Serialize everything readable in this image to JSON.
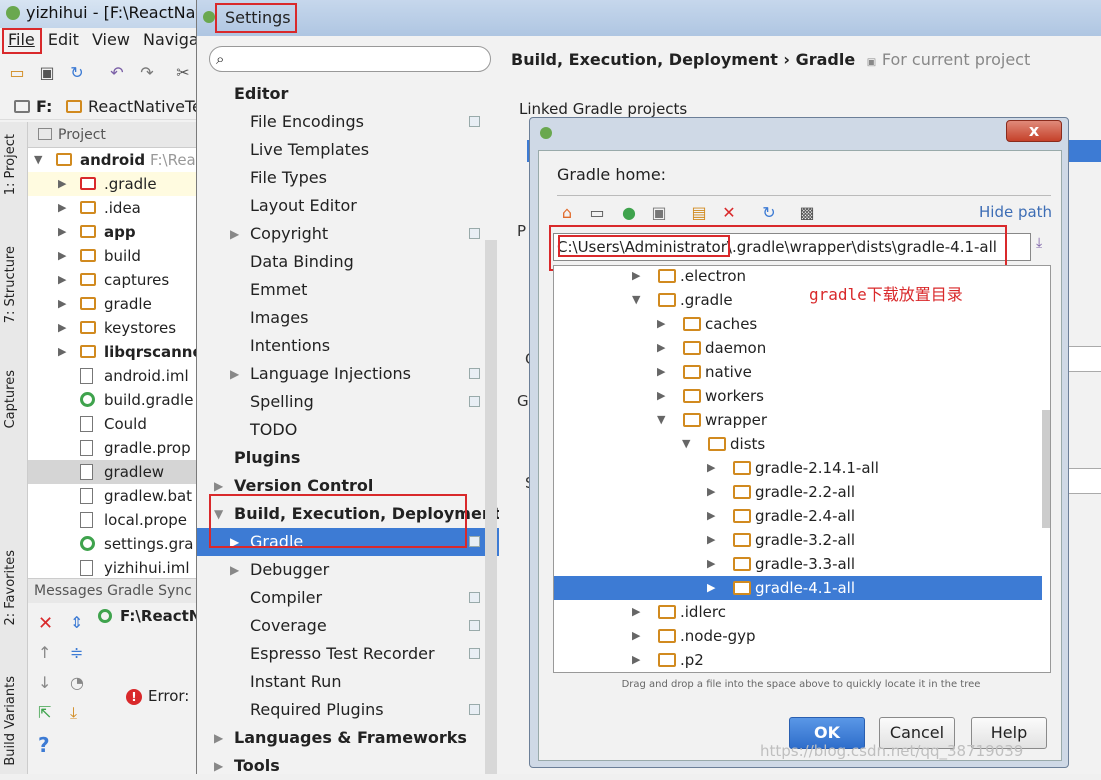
{
  "ide": {
    "title": "yizhihui - [F:\\ReactNativ",
    "menu": [
      "File",
      "Edit",
      "View",
      "Navigat"
    ],
    "breadcrumb": [
      "F:",
      "ReactNativeTe"
    ],
    "project_tab": "Project",
    "side_tabs": [
      "1: Project",
      "7: Structure",
      "Captures",
      "2: Favorites",
      "Build Variants"
    ],
    "tree": [
      {
        "label": "android",
        "extra": "F:\\Rea",
        "bold": true
      },
      {
        "label": ".gradle"
      },
      {
        "label": ".idea"
      },
      {
        "label": "app",
        "bold": true
      },
      {
        "label": "build"
      },
      {
        "label": "captures"
      },
      {
        "label": "gradle"
      },
      {
        "label": "keystores"
      },
      {
        "label": "libqrscanne",
        "bold": true
      },
      {
        "label": "android.iml"
      },
      {
        "label": "build.gradle"
      },
      {
        "label": "Could"
      },
      {
        "label": "gradle.prop"
      },
      {
        "label": "gradlew"
      },
      {
        "label": "gradlew.bat"
      },
      {
        "label": "local.prope"
      },
      {
        "label": "settings.gra"
      },
      {
        "label": "yizhihui.iml"
      }
    ],
    "messages_header": "Messages Gradle Sync",
    "messages_path": "F:\\ReactN",
    "error_text": "Error:"
  },
  "settings": {
    "title": "Settings",
    "search_placeholder": "",
    "tree": [
      {
        "label": "Editor",
        "bold": true
      },
      {
        "label": "File Encodings",
        "copy": true
      },
      {
        "label": "Live Templates"
      },
      {
        "label": "File Types"
      },
      {
        "label": "Layout Editor"
      },
      {
        "label": "Copyright",
        "arrow": true,
        "copy": true
      },
      {
        "label": "Data Binding"
      },
      {
        "label": "Emmet"
      },
      {
        "label": "Images"
      },
      {
        "label": "Intentions"
      },
      {
        "label": "Language Injections",
        "arrow": true,
        "copy": true
      },
      {
        "label": "Spelling",
        "copy": true
      },
      {
        "label": "TODO"
      },
      {
        "label": "Plugins",
        "bold": true
      },
      {
        "label": "Version Control",
        "bold": true,
        "arrow": true
      },
      {
        "label": "Build, Execution, Deployment",
        "bold": true,
        "expanded": true
      },
      {
        "label": "Gradle",
        "arrow": true,
        "copy": true,
        "selected": true
      },
      {
        "label": "Debugger",
        "arrow": true
      },
      {
        "label": "Compiler",
        "copy": true
      },
      {
        "label": "Coverage",
        "copy": true
      },
      {
        "label": "Espresso Test Recorder",
        "copy": true
      },
      {
        "label": "Instant Run"
      },
      {
        "label": "Required Plugins",
        "copy": true
      },
      {
        "label": "Languages & Frameworks",
        "bold": true,
        "arrow": true
      },
      {
        "label": "Tools",
        "bold": true,
        "arrow": true
      }
    ],
    "breadcrumb": "Build, Execution, Deployment › Gradle",
    "for_current_project": "For current project",
    "linked_projects": "Linked Gradle projects",
    "ghost_letters": [
      "P",
      "G",
      "G",
      "S"
    ]
  },
  "gradle_dialog": {
    "label": "Gradle home:",
    "hide_path": "Hide path",
    "path": "C:\\Users\\Administrator\\.gradle\\wrapper\\dists\\gradle-4.1-all",
    "annotation": "gradle下载放置目录",
    "tree": [
      {
        "label": ".electron",
        "depth": 0,
        "arrow": "right"
      },
      {
        "label": ".gradle",
        "depth": 0,
        "arrow": "down"
      },
      {
        "label": "caches",
        "depth": 1,
        "arrow": "right"
      },
      {
        "label": "daemon",
        "depth": 1,
        "arrow": "right"
      },
      {
        "label": "native",
        "depth": 1,
        "arrow": "right"
      },
      {
        "label": "workers",
        "depth": 1,
        "arrow": "right"
      },
      {
        "label": "wrapper",
        "depth": 1,
        "arrow": "down"
      },
      {
        "label": "dists",
        "depth": 2,
        "arrow": "down"
      },
      {
        "label": "gradle-2.14.1-all",
        "depth": 3,
        "arrow": "right"
      },
      {
        "label": "gradle-2.2-all",
        "depth": 3,
        "arrow": "right"
      },
      {
        "label": "gradle-2.4-all",
        "depth": 3,
        "arrow": "right"
      },
      {
        "label": "gradle-3.2-all",
        "depth": 3,
        "arrow": "right"
      },
      {
        "label": "gradle-3.3-all",
        "depth": 3,
        "arrow": "right"
      },
      {
        "label": "gradle-4.1-all",
        "depth": 3,
        "arrow": "right",
        "selected": true
      },
      {
        "label": ".idlerc",
        "depth": 0,
        "arrow": "right"
      },
      {
        "label": ".node-gyp",
        "depth": 0,
        "arrow": "right"
      },
      {
        "label": ".p2",
        "depth": 0,
        "arrow": "right"
      }
    ],
    "hint": "Drag and drop a file into the space above to quickly locate it in the tree",
    "ok": "OK",
    "cancel": "Cancel",
    "help": "Help",
    "close_glyph": "x"
  },
  "watermark": "https://blog.csdn.net/qq_38719039",
  "colors": {
    "accent": "#3d7bd4",
    "annotation_red": "#d9292b",
    "folder": "#d18a1f"
  }
}
